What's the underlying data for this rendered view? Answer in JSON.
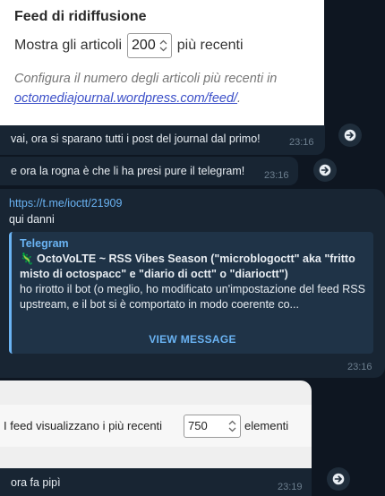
{
  "feed_settings": {
    "heading": "Feed di ridiffusione",
    "show_prefix": "Mostra gli articoli",
    "value": "200",
    "show_suffix": "più recenti",
    "hint_text": "Configura il numero degli articoli più recenti in",
    "hint_link": "octomediajournal.wordpress.com/feed/",
    "hint_end": "."
  },
  "messages": [
    {
      "text": "vai, ora si sparano tutti i post del journal dal primo!",
      "time": "23:16"
    },
    {
      "text": "e ora la rogna è che li ha presi pure il telegram!",
      "time": "23:16"
    },
    {
      "link": "https://t.me/ioctt/21909",
      "text": "qui danni",
      "time": "23:16",
      "preview": {
        "site": "Telegram",
        "title": "🦎 OctoVoLTE ~ RSS Vibes Season (\"microblogoctt\" aka \"fritto misto di octospacc\" e \"diario di octt\" o \"diarioctt\")",
        "description": "ho rirotto il bot (o meglio, ho modificato un'impostazione del feed RSS upstream, e il bot si è comportato in modo coerente co...",
        "view_label": "VIEW MESSAGE"
      }
    },
    {
      "text": "ora fa pipì",
      "time": "23:19"
    }
  ],
  "feed_display": {
    "label": "I feed visualizzano i più recenti",
    "value": "750",
    "unit": "elementi"
  },
  "icons": {
    "forward": "forward-arrow-icon",
    "stepper": "chevron-updown-icon"
  },
  "colors": {
    "background": "#0e1621",
    "bubble": "#182533",
    "accent": "#6ab3f3"
  }
}
